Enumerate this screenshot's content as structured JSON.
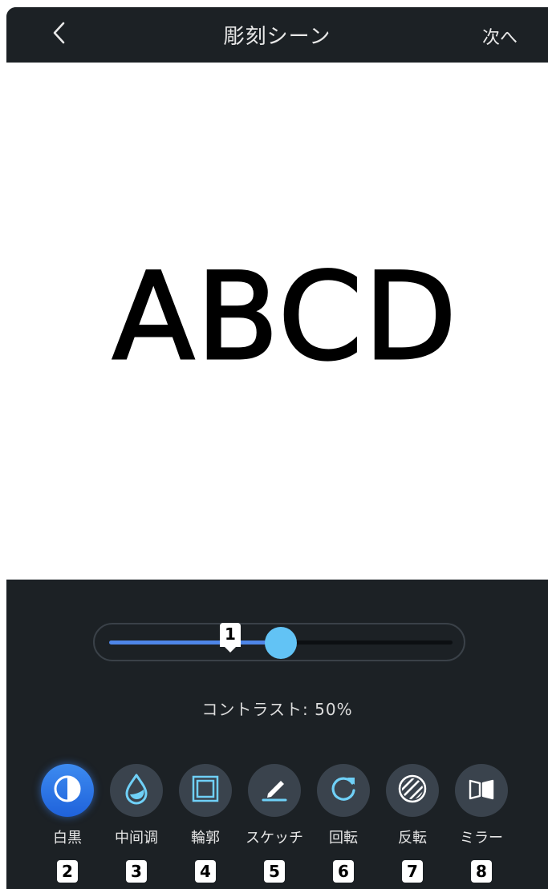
{
  "header": {
    "back_icon": "chevron-left-icon",
    "title": "彫刻シーン",
    "next_label": "次へ"
  },
  "canvas": {
    "preview_text": "ABCD"
  },
  "slider": {
    "value_fraction": 0.5,
    "marker_number": "1",
    "fill_color": "#4e86e8",
    "thumb_color": "#62c3f5"
  },
  "contrast": {
    "label": "コントラスト:  50%"
  },
  "tools": [
    {
      "label": "白黒",
      "icon": "half-circle-icon",
      "number": "2",
      "active": true
    },
    {
      "label": "中间调",
      "icon": "droplet-icon",
      "number": "3",
      "active": false
    },
    {
      "label": "輪郭",
      "icon": "frame-icon",
      "number": "4",
      "active": false
    },
    {
      "label": "スケッチ",
      "icon": "pencil-icon",
      "number": "5",
      "active": false
    },
    {
      "label": "回転",
      "icon": "rotate-icon",
      "number": "6",
      "active": false
    },
    {
      "label": "反転",
      "icon": "striped-circle-icon",
      "number": "7",
      "active": false
    },
    {
      "label": "ミラー",
      "icon": "mirror-icon",
      "number": "8",
      "active": false
    }
  ],
  "colors": {
    "background": "#1c2125",
    "accent": "#3d8bf0",
    "icon_stroke": "#6fd0f7"
  }
}
